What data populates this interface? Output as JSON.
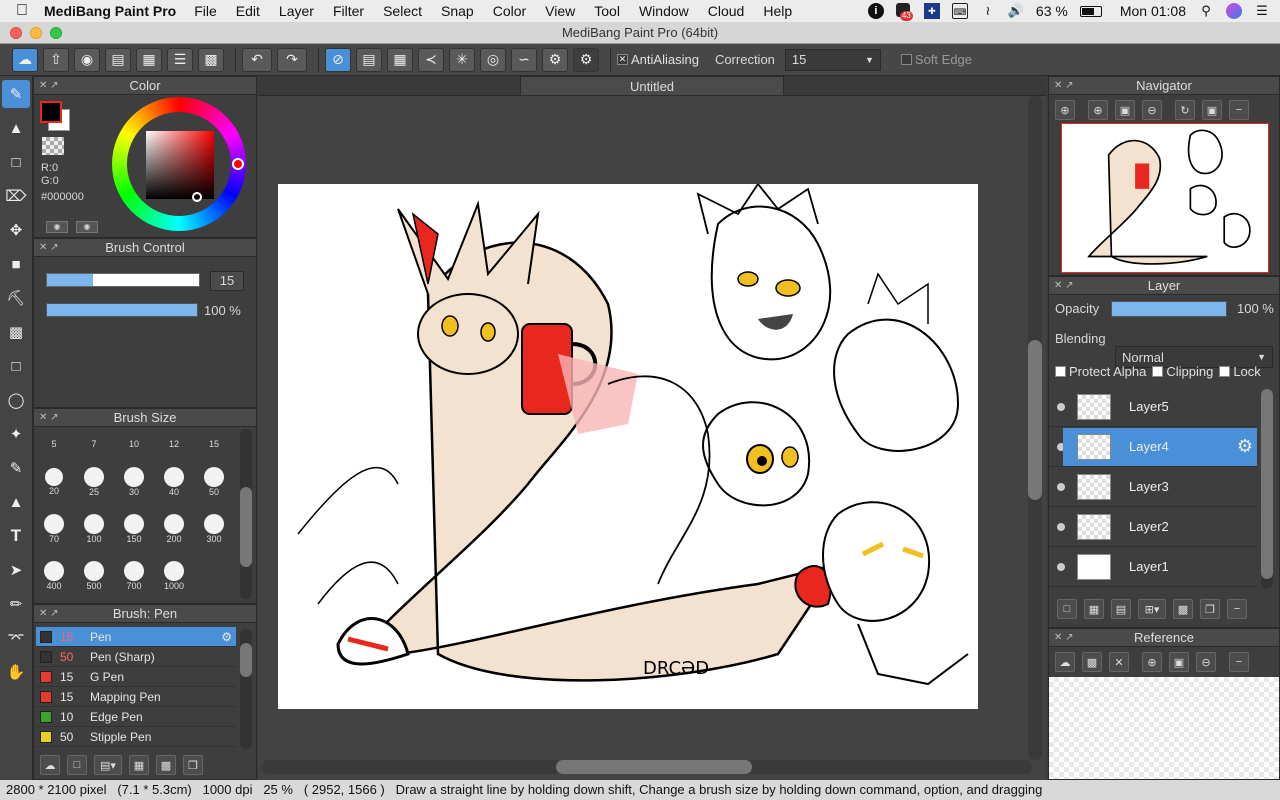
{
  "menubar": {
    "app_name": "MediBang Paint Pro",
    "items": [
      "File",
      "Edit",
      "Layer",
      "Filter",
      "Select",
      "Snap",
      "Color",
      "View",
      "Tool",
      "Window",
      "Cloud",
      "Help"
    ],
    "notification_count": "43",
    "battery": "63 %",
    "clock": "Mon 01:08"
  },
  "window": {
    "title": "MediBang Paint Pro (64bit)",
    "doc_tab": "Untitled"
  },
  "toolbar": {
    "antialiasing_label": "AntiAliasing",
    "correction_label": "Correction",
    "correction_value": "15",
    "soft_edge_label": "Soft Edge"
  },
  "color_panel": {
    "title": "Color",
    "r": "R:0",
    "g": "G:0",
    "hex": "#000000",
    "fg_color": "#000000",
    "bg_color": "#ffffff"
  },
  "brush_control": {
    "title": "Brush Control",
    "size_value": "15",
    "opacity_value": "100 %"
  },
  "brush_size": {
    "title": "Brush Size",
    "top_row": [
      "5",
      "7",
      "10",
      "12",
      "15"
    ],
    "rows": [
      [
        "20",
        "25",
        "30",
        "40",
        "50"
      ],
      [
        "70",
        "100",
        "150",
        "200",
        "300"
      ],
      [
        "400",
        "500",
        "700",
        "1000"
      ]
    ]
  },
  "brush_list": {
    "title": "Brush: Pen",
    "items": [
      {
        "size": "15",
        "name": "Pen",
        "color": "#333333",
        "active": true
      },
      {
        "size": "50",
        "name": "Pen (Sharp)",
        "color": "#333333"
      },
      {
        "size": "15",
        "name": "G Pen",
        "color": "#e83a30"
      },
      {
        "size": "15",
        "name": "Mapping Pen",
        "color": "#e83a30"
      },
      {
        "size": "10",
        "name": "Edge Pen",
        "color": "#3aa52a"
      },
      {
        "size": "50",
        "name": "Stipple Pen",
        "color": "#e8d020"
      }
    ]
  },
  "navigator": {
    "title": "Navigator"
  },
  "layer_panel": {
    "title": "Layer",
    "opacity_label": "Opacity",
    "opacity_value": "100 %",
    "blending_label": "Blending",
    "blending_value": "Normal",
    "protect_alpha": "Protect Alpha",
    "clipping": "Clipping",
    "lock": "Lock",
    "layers": [
      "Layer5",
      "Layer4",
      "Layer3",
      "Layer2",
      "Layer1"
    ],
    "active_layer": "Layer4"
  },
  "reference": {
    "title": "Reference"
  },
  "status": {
    "dimensions": "2800 * 2100 pixel",
    "physical": "(7.1 * 5.3cm)",
    "dpi": "1000 dpi",
    "zoom": "25 %",
    "coords": "( 2952, 1566 )",
    "hint": "Draw a straight line by holding down shift, Change a brush size by holding down command, option, and dragging"
  },
  "accent": "#4a90d9"
}
